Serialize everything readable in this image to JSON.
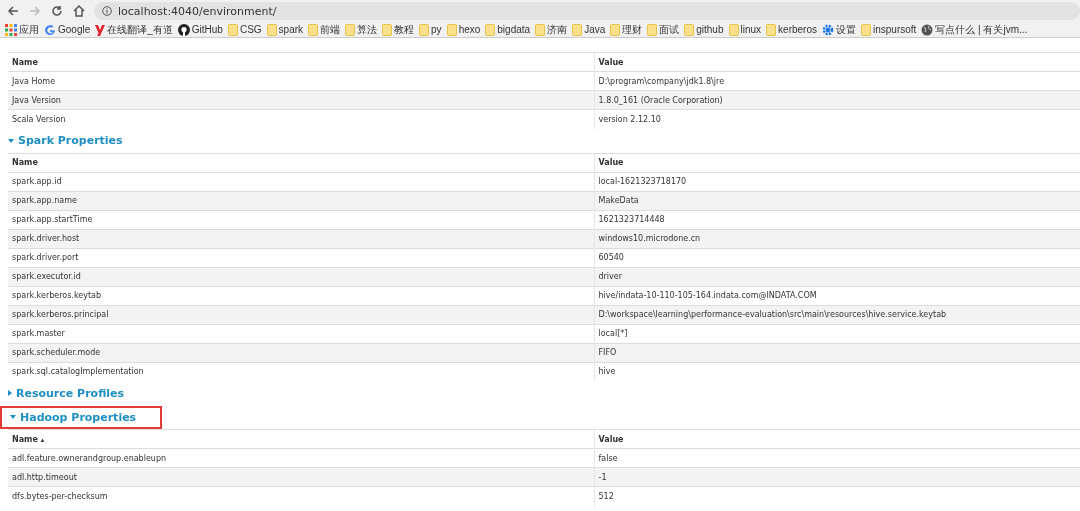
{
  "browser": {
    "url": "localhost:4040/environment/",
    "bookmarks": [
      {
        "kind": "apps",
        "label": "应用"
      },
      {
        "kind": "google",
        "label": "Google"
      },
      {
        "kind": "youdao",
        "label": "在线翻译_有道"
      },
      {
        "kind": "github",
        "label": "GitHub"
      },
      {
        "kind": "folder",
        "label": "CSG"
      },
      {
        "kind": "folder",
        "label": "spark"
      },
      {
        "kind": "folder",
        "label": "前端"
      },
      {
        "kind": "folder",
        "label": "算法"
      },
      {
        "kind": "folder",
        "label": "教程"
      },
      {
        "kind": "folder",
        "label": "py"
      },
      {
        "kind": "folder",
        "label": "hexo"
      },
      {
        "kind": "folder",
        "label": "bigdata"
      },
      {
        "kind": "folder",
        "label": "济南"
      },
      {
        "kind": "folder",
        "label": "Java"
      },
      {
        "kind": "folder",
        "label": "理财"
      },
      {
        "kind": "folder",
        "label": "面试"
      },
      {
        "kind": "folder",
        "label": "github"
      },
      {
        "kind": "folder",
        "label": "linux"
      },
      {
        "kind": "folder",
        "label": "kerberos"
      },
      {
        "kind": "settings",
        "label": "设置"
      },
      {
        "kind": "folder",
        "label": "inspursoft"
      },
      {
        "kind": "globe",
        "label": "写点什么 | 有关jvm..."
      }
    ]
  },
  "sections": [
    {
      "columns": [
        "Name",
        "Value"
      ],
      "rows": [
        [
          "Java Home",
          "D:\\program\\company\\jdk1.8\\jre"
        ],
        [
          "Java Version",
          "1.8.0_161 (Oracle Corporation)"
        ],
        [
          "Scala Version",
          "version 2.12.10"
        ]
      ]
    },
    {
      "title": "Spark Properties",
      "expanded": true,
      "highlighted": false,
      "columns": [
        "Name",
        "Value"
      ],
      "rows": [
        [
          "spark.app.id",
          "local-1621323718170"
        ],
        [
          "spark.app.name",
          "MakeData"
        ],
        [
          "spark.app.startTime",
          "1621323714448"
        ],
        [
          "spark.driver.host",
          "windows10.microdone.cn"
        ],
        [
          "spark.driver.port",
          "60540"
        ],
        [
          "spark.executor.id",
          "driver"
        ],
        [
          "spark.kerberos.keytab",
          "hive/indata-10-110-105-164.indata.com@INDATA.COM"
        ],
        [
          "spark.kerberos.principal",
          "D:\\workspace\\learning\\performance-evaluation\\src\\main\\resources\\hive.service.keytab"
        ],
        [
          "spark.master",
          "local[*]"
        ],
        [
          "spark.scheduler.mode",
          "FIFO"
        ],
        [
          "spark.sql.catalogImplementation",
          "hive"
        ]
      ]
    },
    {
      "title": "Resource Profiles",
      "expanded": false,
      "highlighted": false
    },
    {
      "title": "Hadoop Properties",
      "expanded": true,
      "highlighted": true,
      "columns": [
        "Name",
        "Value"
      ],
      "sort_indicator": "▴",
      "rows": [
        [
          "adl.feature.ownerandgroup.enableupn",
          "false"
        ],
        [
          "adl.http.timeout",
          "-1"
        ],
        [
          "dfs.bytes-per-checksum",
          "512"
        ]
      ]
    }
  ]
}
